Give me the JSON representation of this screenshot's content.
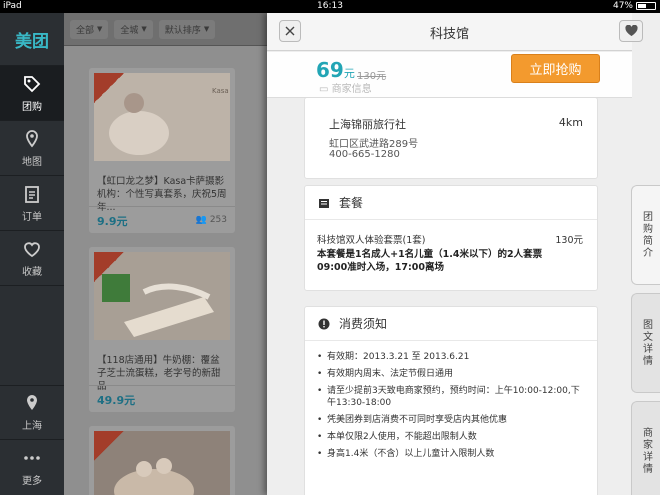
{
  "status": {
    "device": "iPad",
    "time": "16:13",
    "battery": "47%",
    "battery_level": 0.47
  },
  "sidebar": {
    "logo": "美团",
    "items": [
      {
        "label": "团购",
        "icon": "tag-icon",
        "active": true
      },
      {
        "label": "地图",
        "icon": "map-pin-icon"
      },
      {
        "label": "订单",
        "icon": "clipboard-icon"
      },
      {
        "label": "收藏",
        "icon": "heart-icon"
      }
    ],
    "bottom": [
      {
        "label": "上海",
        "icon": "location-icon"
      },
      {
        "label": "更多",
        "icon": "more-dots-icon"
      }
    ]
  },
  "filters": [
    "全部",
    "全城",
    "默认排序"
  ],
  "deals": [
    {
      "badge": "今日新单",
      "title": "【虹口龙之梦】Kasa卡萨摄影机构：个性写真套系，庆祝5周年...",
      "price": "9.9元",
      "sold": "253"
    },
    {
      "badge": "今日新单",
      "title": "【118店通用】牛奶棚：覆盆子芝士流蛋糕，老字号的新甜品",
      "price": "49.9元",
      "sold": ""
    },
    {
      "badge": "今日新单",
      "title": "",
      "price": "",
      "sold": ""
    }
  ],
  "detail": {
    "title": "科技馆",
    "price": "69",
    "price_unit": "元",
    "original_price": "130元",
    "ghost_label": "商家信息",
    "buy_button": "立即抢购",
    "merchant": {
      "name": "上海锦丽旅行社",
      "distance": "4km",
      "address": "虹口区武进路289号",
      "phone": "400-665-1280"
    },
    "package": {
      "header": "套餐",
      "item": "科技馆双人体验套票(1套)",
      "amount": "130元",
      "desc1": "本套餐是1名成人+1名儿童（1.4米以下）的2人套票",
      "desc2": "09:00准时入场，17:00离场"
    },
    "notice": {
      "header": "消费须知",
      "items": [
        "有效期：2013.3.21 至 2013.6.21",
        "有效期内周末、法定节假日通用",
        "请至少提前3天致电商家预约，预约时间：上午10:00-12:00,下午13:30-18:00",
        "凭美团券到店消费不可同时享受店内其他优惠",
        "本单仅限2人使用，不能超出限制人数",
        "身高1.4米（不含）以上儿童计入限制人数"
      ]
    }
  },
  "tabs": [
    "团购简介",
    "图文详情",
    "商家详情"
  ]
}
